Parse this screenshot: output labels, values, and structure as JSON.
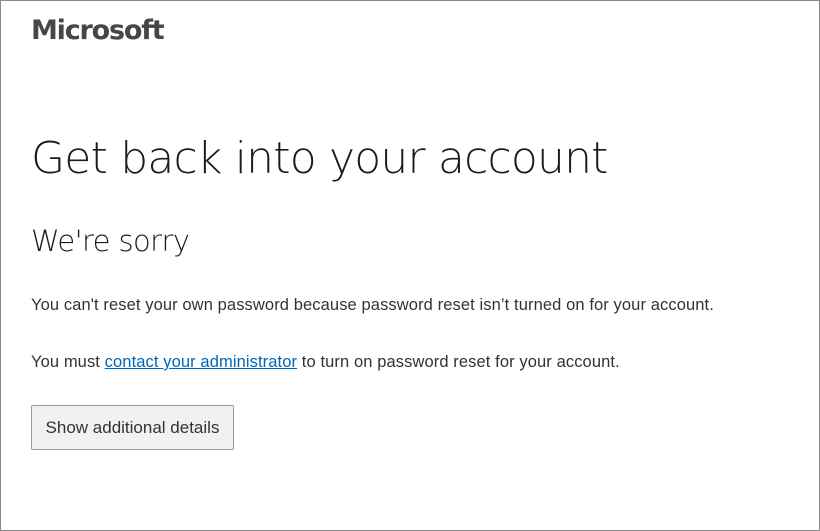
{
  "brand": {
    "logo_text": "Microsoft"
  },
  "page": {
    "title": "Get back into your account",
    "subtitle": "We're sorry",
    "message_line1": "You can't reset your own password because password reset isn’t turned on for your account.",
    "message_line2_prefix": "You must ",
    "message_line2_link": "contact your administrator",
    "message_line2_suffix": " to turn on password reset for your account."
  },
  "actions": {
    "details_button_label": "Show additional details"
  },
  "colors": {
    "link": "#0067b8",
    "text": "#1b1b1b",
    "button_bg": "#f1f1f1"
  }
}
